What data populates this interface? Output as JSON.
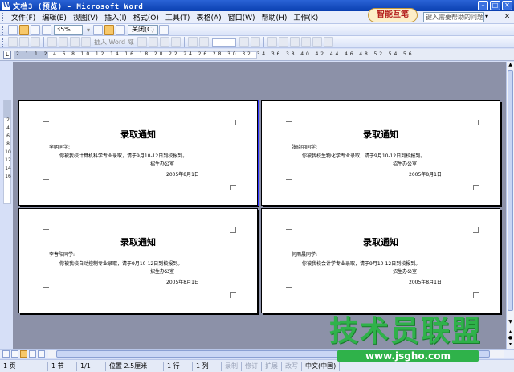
{
  "window": {
    "title": "文档3 (预览) - Microsoft Word"
  },
  "menu": [
    "文件(F)",
    "编辑(E)",
    "视图(V)",
    "插入(I)",
    "格式(O)",
    "工具(T)",
    "表格(A)",
    "窗口(W)",
    "帮助(H)",
    "工作(K)"
  ],
  "logo_text": "智能互笔",
  "help": {
    "placeholder": "键入需要帮助的问题"
  },
  "toolbar": {
    "zoom": "35%",
    "close_label": "关闭(C)",
    "insert_word_label": "插入 Word 域"
  },
  "ruler": {
    "numbers": "2 1 1 2 4 6 8 10 12 14 16 18 20 22 24 26 28 30 32 34 36 38 40 42 44 46 48 52 54 56",
    "vertical_numbers": [
      "2",
      "4",
      "6",
      "8",
      "10",
      "12",
      "14",
      "16"
    ]
  },
  "pages": [
    {
      "title": "录取通知",
      "greeting": "李明同学:",
      "body": "你被我校计算机科学专业录取，请于9月10-12日到校报到。",
      "signer": "招生办公室",
      "date": "2005年8月1日"
    },
    {
      "title": "录取通知",
      "greeting": "张晓明同学:",
      "body": "你被我校生物化学专业录取，请于9月10-12日到校报到。",
      "signer": "招生办公室",
      "date": "2005年8月1日"
    },
    {
      "title": "录取通知",
      "greeting": "李春阳同学:",
      "body": "你被我校自动控制专业录取，请于9月10-12日到校报到。",
      "signer": "招生办公室",
      "date": "2005年8月1日"
    },
    {
      "title": "录取通知",
      "greeting": "何雨晨同学:",
      "body": "你被我校会计学专业录取，请于9月10-12日到校报到。",
      "signer": "招生办公室",
      "date": "2005年8月1日"
    }
  ],
  "status": {
    "page": "1 页",
    "section": "1 节",
    "page_of": "1/1",
    "position": "位置 2.5厘米",
    "line": "1 行",
    "col": "1 列",
    "rec": "录制",
    "trk": "修订",
    "ext": "扩展",
    "ovr": "改写",
    "lang": "中文(中国)"
  },
  "watermark": {
    "main": "技术员联盟",
    "url": "www.jsgho.com"
  },
  "colors": {
    "title_bar": "#0a3fb0",
    "workspace": "#8c91a8",
    "watermark_green": "#2fb24a"
  }
}
